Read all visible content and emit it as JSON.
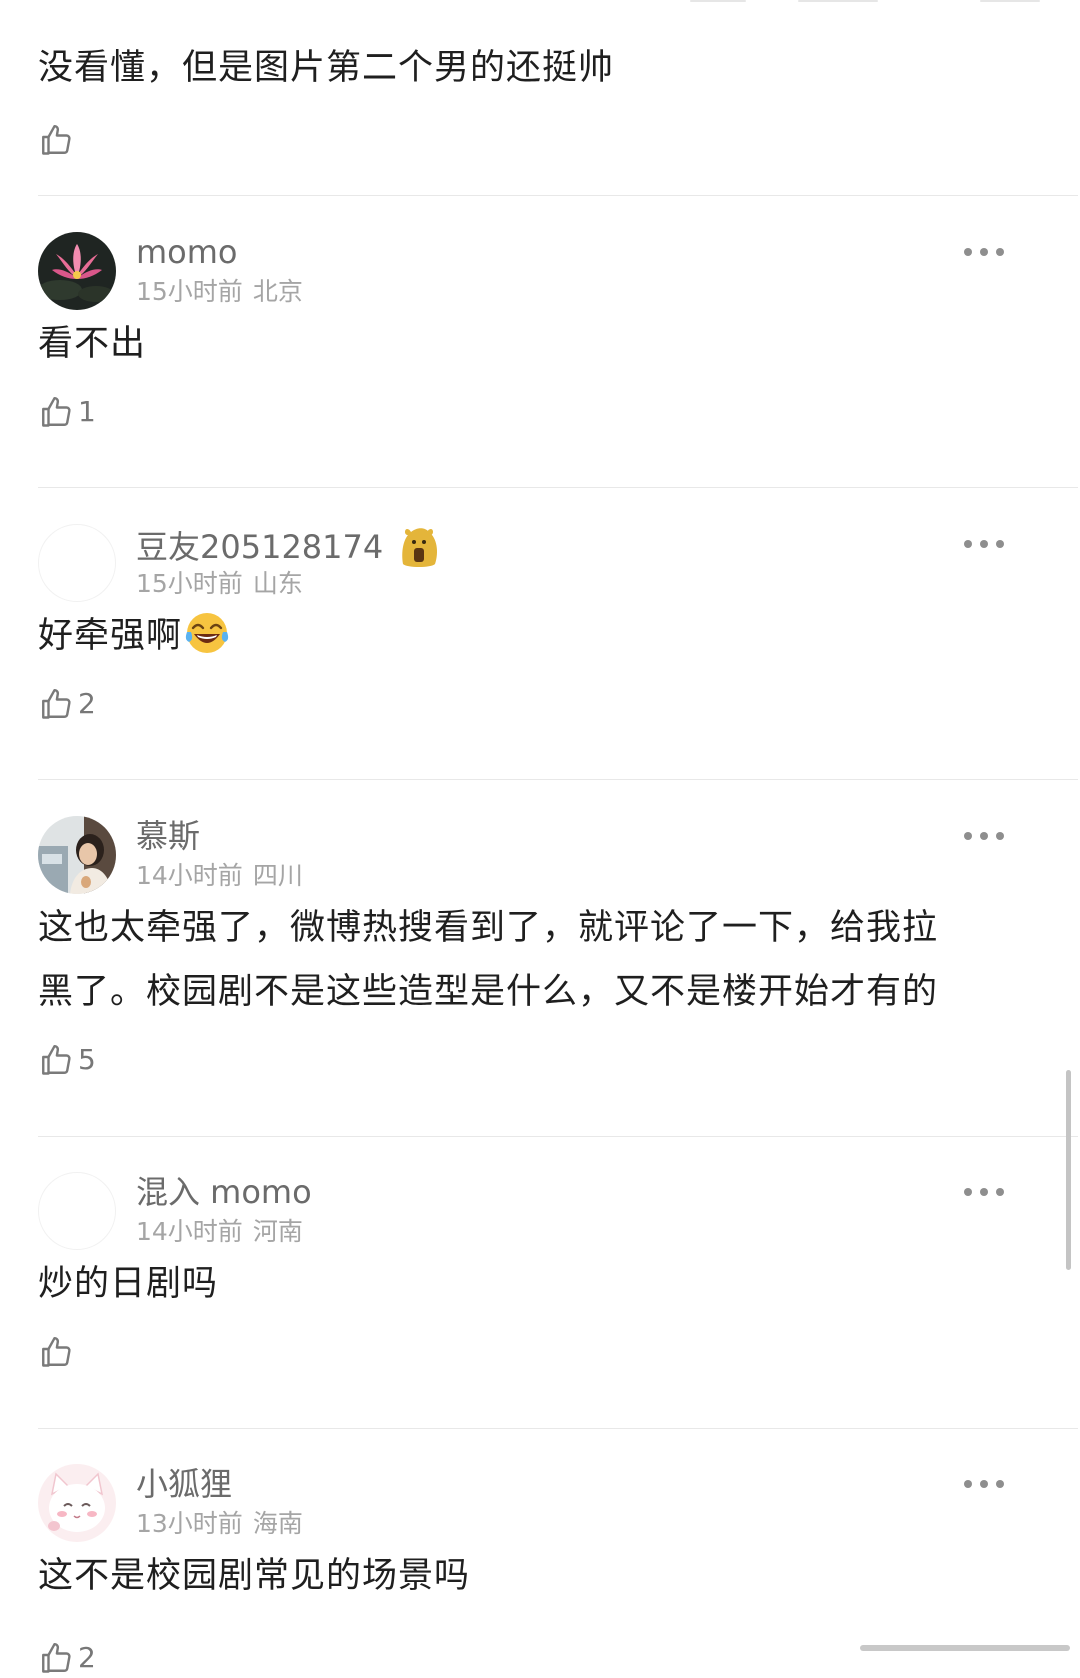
{
  "comments": [
    {
      "text": "没看懂，但是图片第二个男的还挺帅",
      "likes": ""
    },
    {
      "username": "momo",
      "time": "15小时前",
      "location": "北京",
      "text": "看不出",
      "likes": "1"
    },
    {
      "username": "豆友205128174",
      "time": "15小时前",
      "location": "山东",
      "text": "好牵强啊",
      "likes": "2"
    },
    {
      "username": "慕斯",
      "time": "14小时前",
      "location": "四川",
      "text_line1": "这也太牵强了，微博热搜看到了，就评论了一下，给我拉",
      "text_line2": "黑了。校园剧不是这些造型是什么，又不是楼开始才有的",
      "likes": "5"
    },
    {
      "username": "混入 momo",
      "time": "14小时前",
      "location": "河南",
      "text": "炒的日剧吗",
      "likes": ""
    },
    {
      "username": "小狐狸",
      "time": "13小时前",
      "location": "海南",
      "text": "这不是校园剧常见的场景吗",
      "likes": "2"
    }
  ],
  "icons": {
    "like": "thumbs-up-icon",
    "more": "more-dots-icon",
    "emoji": "tears-of-joy-emoji",
    "badge": "yellow-badge-icon"
  },
  "colors": {
    "username": "#6b6b6b",
    "meta": "#a5a5a5",
    "text": "#1f1f1f",
    "icon": "#8e8e8e",
    "divider": "#e8e8e8"
  }
}
